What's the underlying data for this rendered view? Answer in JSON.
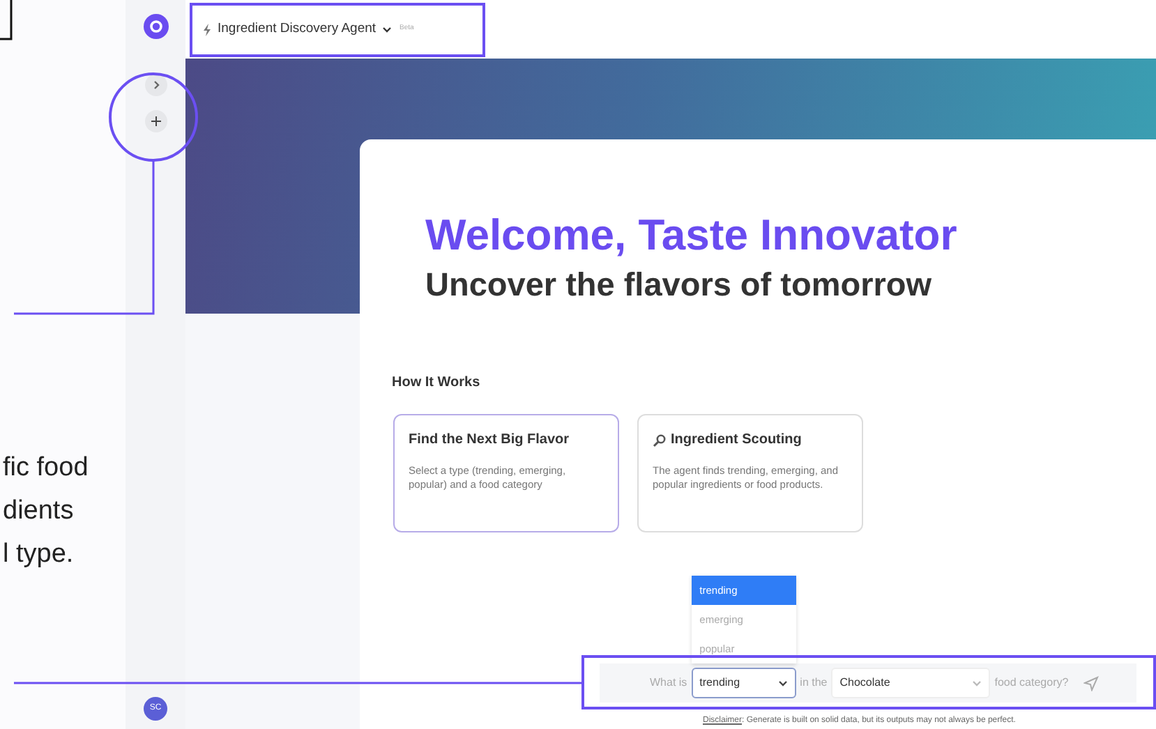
{
  "annotation": {
    "lines": [
      "fic food",
      "dients",
      "l type."
    ]
  },
  "sidebar": {
    "buttons": [
      {
        "kind": "expand"
      },
      {
        "kind": "add"
      }
    ],
    "avatar": "SC"
  },
  "header": {
    "title": "Ingredient Discovery Agent",
    "badge": "Beta"
  },
  "welcome": {
    "title": "Welcome, Taste Innovator",
    "subtitle": "Uncover the flavors of tomorrow"
  },
  "how_it_works": {
    "heading": "How It Works",
    "cards": [
      {
        "kind": "plain",
        "title": "Find the Next Big Flavor",
        "text": "Select a type (trending, emerging, popular) and a food category",
        "selected": true
      },
      {
        "kind": "search",
        "title": "Ingredient Scouting",
        "text": "The agent finds trending, emerging, and popular ingredients or food products.",
        "selected": false
      }
    ]
  },
  "query": {
    "prefix": "What is",
    "type": {
      "value": "trending",
      "expanded": true,
      "options": [
        {
          "label": "trending",
          "selected": true
        },
        {
          "label": "emerging",
          "selected": false
        },
        {
          "label": "popular",
          "selected": false
        }
      ]
    },
    "middle": "in the",
    "category": "Chocolate",
    "suffix": "food category?"
  },
  "disclaimer": {
    "label": "Disclaimer",
    "text": ": Generate is built on solid data, but its outputs may not always be perfect."
  }
}
